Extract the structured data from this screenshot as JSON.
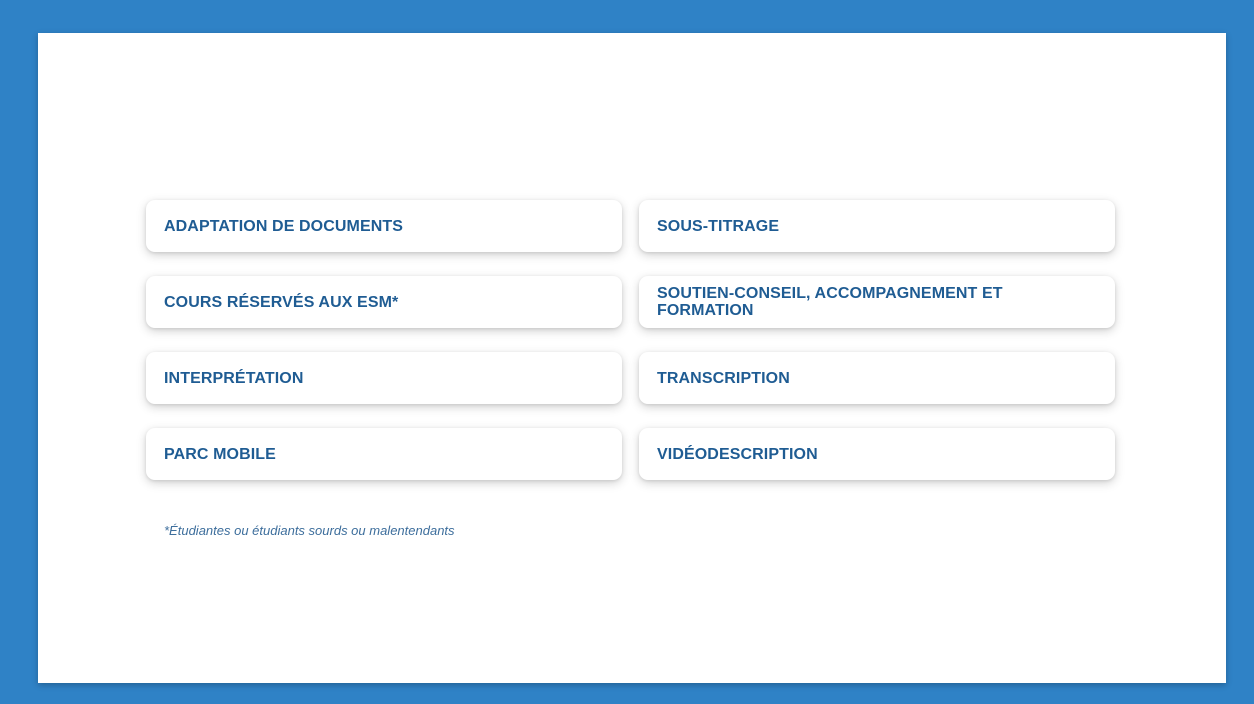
{
  "services": {
    "items": [
      {
        "label": "ADAPTATION DE DOCUMENTS"
      },
      {
        "label": "SOUS-TITRAGE"
      },
      {
        "label": "COURS RÉSERVÉS AUX ESM*"
      },
      {
        "label": "SOUTIEN-CONSEIL, ACCOMPAGNEMENT ET FORMATION"
      },
      {
        "label": "INTERPRÉTATION"
      },
      {
        "label": "TRANSCRIPTION"
      },
      {
        "label": "PARC MOBILE"
      },
      {
        "label": "VIDÉODESCRIPTION"
      }
    ]
  },
  "footnote": "*Étudiantes ou étudiants sourds ou malentendants",
  "colors": {
    "background": "#2f82c6",
    "panel": "#ffffff",
    "text": "#1f5c93"
  }
}
